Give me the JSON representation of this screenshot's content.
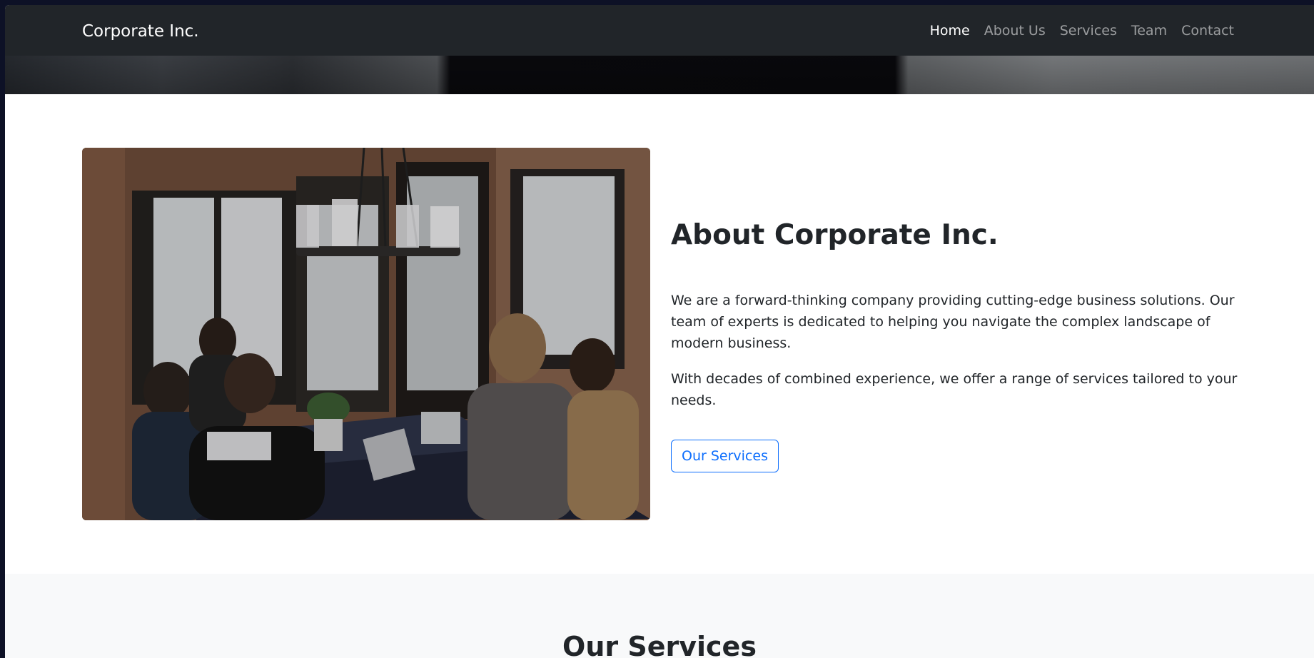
{
  "navbar": {
    "brand": "Corporate Inc.",
    "links": [
      {
        "label": "Home",
        "active": true
      },
      {
        "label": "About Us",
        "active": false
      },
      {
        "label": "Services",
        "active": false
      },
      {
        "label": "Team",
        "active": false
      },
      {
        "label": "Contact",
        "active": false
      }
    ]
  },
  "about": {
    "title": "About Corporate Inc.",
    "paragraph1": "We are a forward-thinking company providing cutting-edge business solutions. Our team of experts is dedicated to helping you navigate the complex landscape of modern business.",
    "paragraph2": "With decades of combined experience, we offer a range of services tailored to your needs.",
    "button_label": "Our Services",
    "image_subject": "team-meeting-photo"
  },
  "services": {
    "title": "Our Services"
  },
  "colors": {
    "navbar_bg": "#212529",
    "primary": "#0d6efd",
    "text": "#212529",
    "section_alt_bg": "#f8f9fa"
  }
}
